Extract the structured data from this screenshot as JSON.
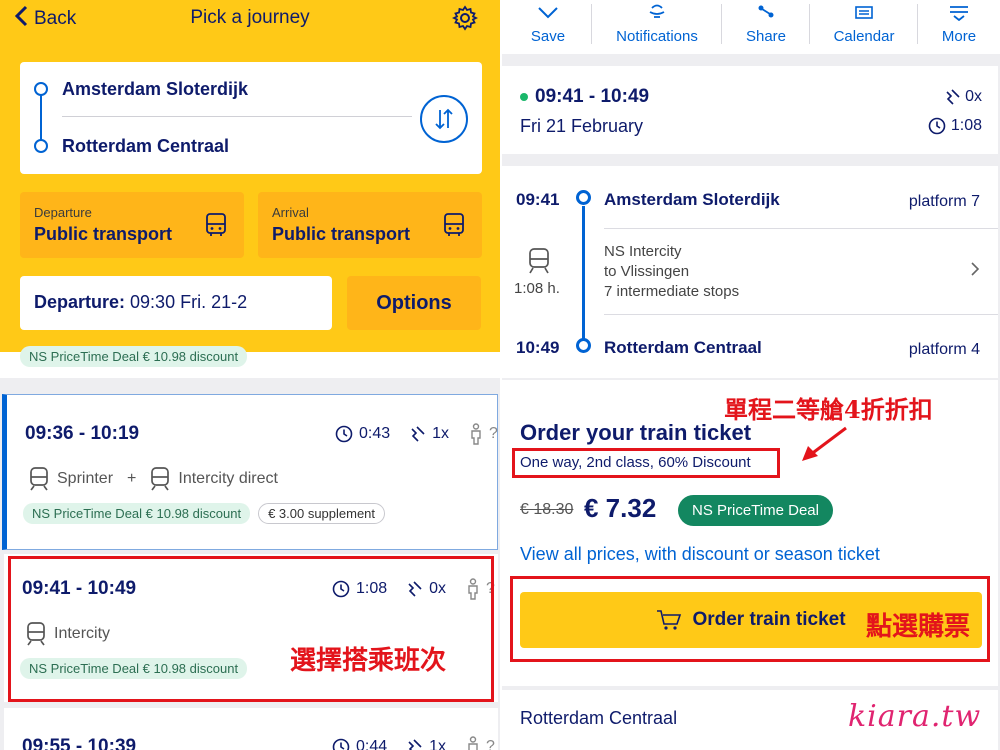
{
  "left": {
    "header": {
      "back_label": "Back",
      "title": "Pick a journey"
    },
    "route": {
      "from": "Amsterdam Sloterdijk",
      "to": "Rotterdam Centraal"
    },
    "departure_mode": {
      "label": "Departure",
      "value": "Public transport"
    },
    "arrival_mode": {
      "label": "Arrival",
      "value": "Public transport"
    },
    "departure_time": {
      "label": "Departure:",
      "value": " 09:30 Fri. 21-2"
    },
    "options_label": "Options",
    "prev_deal": "NS PriceTime Deal € 10.98 discount",
    "journeys": [
      {
        "time": "09:36 - 10:19",
        "duration": "0:43",
        "transfers": "1x",
        "crowding": "?",
        "mode1": "Sprinter",
        "plus": "+",
        "mode2": "Intercity direct",
        "deal": "NS PriceTime Deal € 10.98 discount",
        "supplement": "€ 3.00 supplement"
      },
      {
        "time": "09:41 - 10:49",
        "duration": "1:08",
        "transfers": "0x",
        "crowding": "?",
        "mode1": "Intercity",
        "deal": "NS PriceTime Deal € 10.98 discount"
      },
      {
        "time": "09:55 - 10:39",
        "duration": "0:44",
        "transfers": "1x",
        "crowding": "?"
      }
    ],
    "annotation": "選擇搭乘班次"
  },
  "right": {
    "toolbar": [
      {
        "label": "Save",
        "icon": "chevron-down-icon"
      },
      {
        "label": "Notifications",
        "icon": "bell-icon"
      },
      {
        "label": "Share",
        "icon": "share-icon"
      },
      {
        "label": "Calendar",
        "icon": "calendar-icon"
      },
      {
        "label": "More",
        "icon": "more-icon"
      }
    ],
    "summary": {
      "time": "09:41 - 10:49",
      "date": "Fri 21 February",
      "transfers": "0x",
      "duration": "1:08",
      "status_color": "#1ab76a"
    },
    "legs": {
      "dep_time": "09:41",
      "dep_station": "Amsterdam Sloterdijk",
      "dep_platform": "platform 7",
      "train_type": "NS Intercity",
      "direction": "to Vlissingen",
      "stops": "7 intermediate stops",
      "duration": "1:08 h.",
      "arr_time": "10:49",
      "arr_station": "Rotterdam Centraal",
      "arr_platform": "platform 4"
    },
    "order": {
      "annotation_top": "單程二等艙4折折扣",
      "title": "Order your train ticket",
      "subtitle": "One way, 2nd class, 60% Discount",
      "old_price": "€ 18.30",
      "new_price": "€ 7.32",
      "badge": "NS PriceTime Deal",
      "view_prices": "View all prices, with discount or season ticket",
      "button": "Order train ticket",
      "annotation_btn": "點選購票"
    },
    "bottom_station": "Rotterdam Centraal",
    "watermark": "kiara.tw"
  },
  "colors": {
    "ns_yellow": "#ffc917",
    "ns_blue": "#0063d3",
    "ns_navy": "#0e1b6b",
    "deal_green": "#138760",
    "annotation_red": "#e3141b",
    "watermark_pink": "#e02470"
  }
}
